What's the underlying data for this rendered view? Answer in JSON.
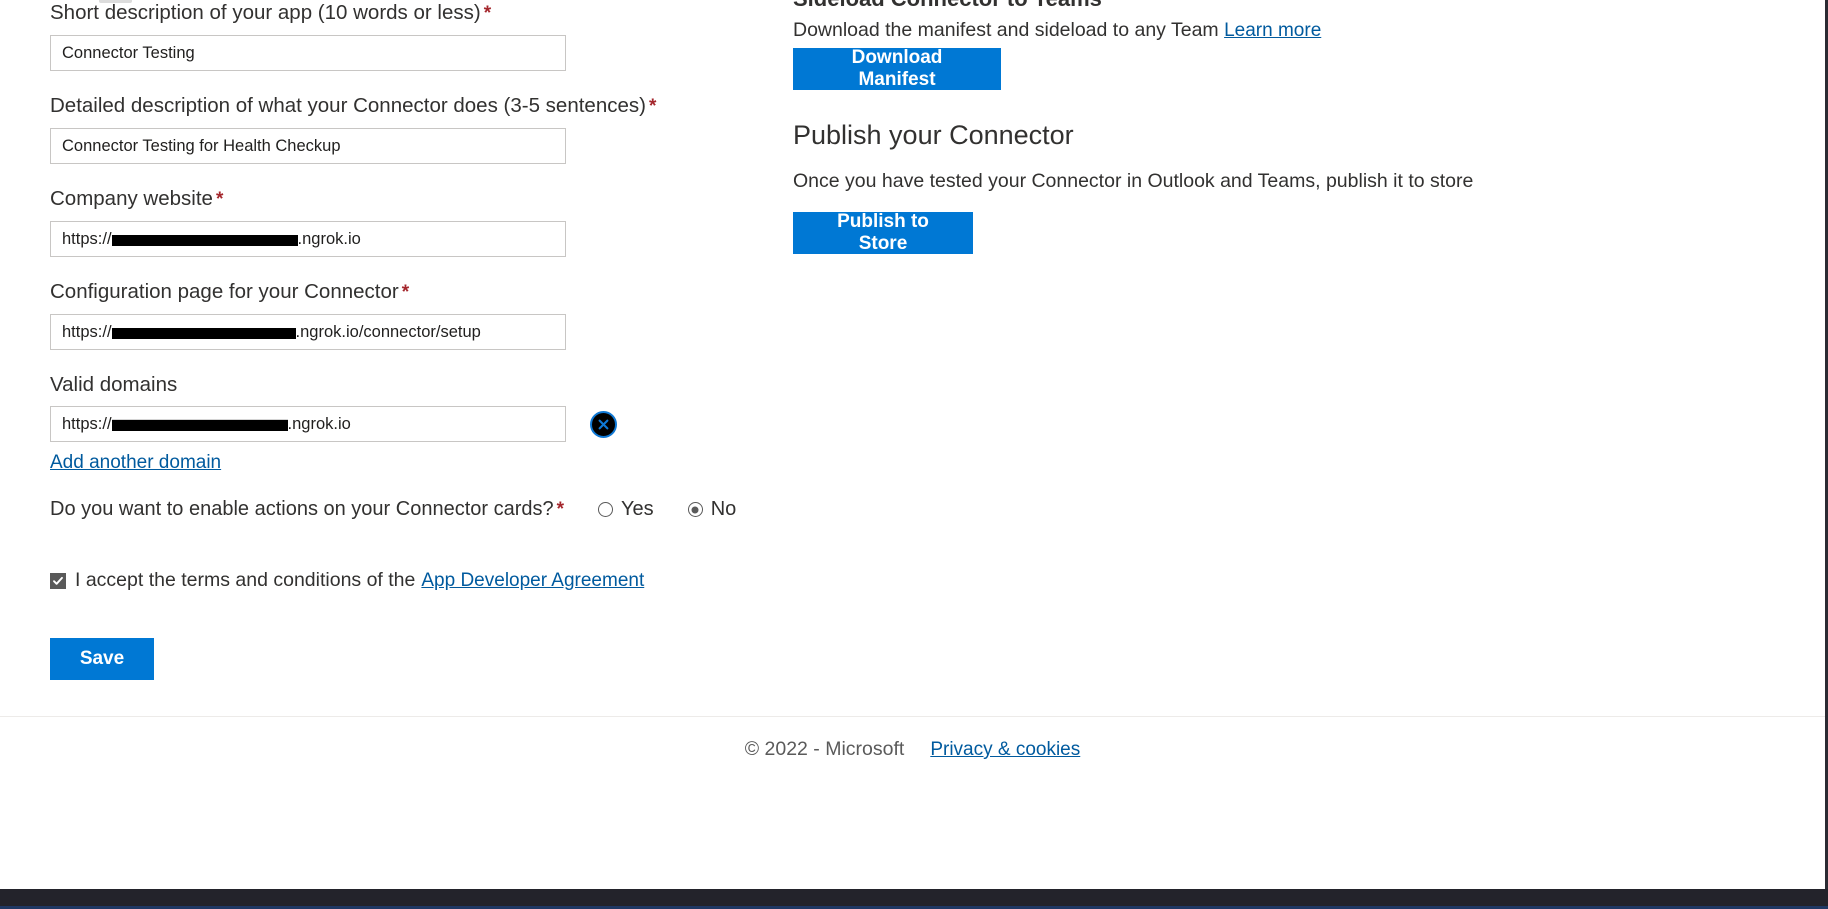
{
  "form": {
    "short_description": {
      "label": "Short description of your app (10 words or less)",
      "required_marker": "*",
      "value": "Connector Testing"
    },
    "detailed_description": {
      "label": "Detailed description of what your Connector does (3-5 sentences)",
      "required_marker": "*",
      "value": "Connector Testing for Health Checkup"
    },
    "company_website": {
      "label": "Company website",
      "required_marker": "*",
      "prefix": "https://",
      "suffix": ".ngrok.io"
    },
    "configuration_page": {
      "label": "Configuration page for your Connector",
      "required_marker": "*",
      "prefix": "https://",
      "suffix": ".ngrok.io/connector/setup"
    },
    "valid_domains": {
      "label": "Valid domains",
      "prefix": "https://",
      "suffix": ".ngrok.io",
      "remove_title": "Remove domain",
      "add_link": "Add another domain"
    },
    "enable_actions": {
      "label": "Do you want to enable actions on your Connector cards?",
      "required_marker": "*",
      "options": [
        "Yes",
        "No"
      ],
      "selected": "No"
    },
    "terms": {
      "checked": true,
      "text": "I accept the terms and conditions of the",
      "link": "App Developer Agreement"
    },
    "save_label": "Save"
  },
  "sideload": {
    "heading": "Sideload Connector to Teams",
    "description": "Download the manifest and sideload to any Team",
    "learn_more": "Learn more",
    "download_label": "Download Manifest"
  },
  "publish": {
    "heading": "Publish your Connector",
    "description": "Once you have tested your Connector in Outlook and Teams, publish it to store",
    "button_label": "Publish to Store"
  },
  "footer": {
    "copyright": "© 2022 - Microsoft",
    "privacy_link": "Privacy & cookies"
  },
  "colors": {
    "accent": "#0078d4",
    "link": "#005a9e",
    "required": "#a4262c",
    "text": "#323130"
  }
}
